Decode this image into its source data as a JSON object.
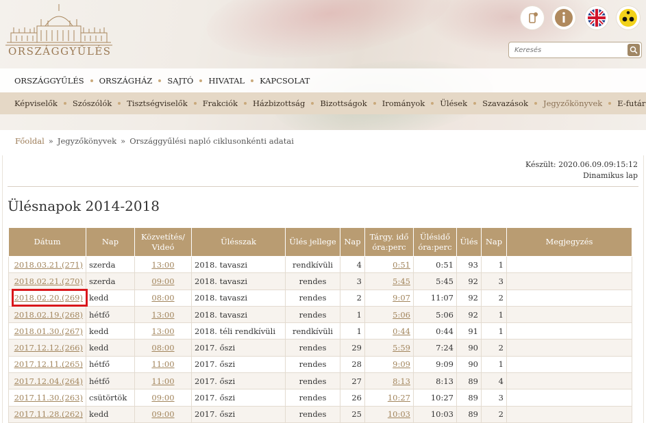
{
  "header": {
    "logo_text": "ORSZÁGGYŰLÉS",
    "search_placeholder": "Keresés",
    "icons": [
      "mobile-app-icon",
      "info-icon",
      "uk-flag-icon",
      "accessibility-icon"
    ]
  },
  "main_nav": [
    "ORSZÁGGYŰLÉS",
    "ORSZÁGHÁZ",
    "SAJTÓ",
    "HIVATAL",
    "KAPCSOLAT"
  ],
  "sub_nav": {
    "items": [
      "Képviselők",
      "Szószólók",
      "Tisztségviselők",
      "Frakciók",
      "Házbizottság",
      "Bizottságok",
      "Irományok",
      "Ülések",
      "Szavazások",
      "Jegyzőkönyvek",
      "E-futár"
    ],
    "active": "Jegyzőkönyvek"
  },
  "breadcrumb": {
    "home": "Főoldal",
    "separator": "»",
    "section": "Jegyzőkönyvek",
    "current": "Országgyűlési napló ciklusonkénti adatai"
  },
  "content": {
    "created": "Készült: 2020.06.09.09:15:12",
    "dynamic": "Dinamikus lap",
    "title": "Ülésnapok 2014-2018"
  },
  "table": {
    "headers": [
      "Dátum",
      "Nap",
      "Közvetítés/ Videó",
      "Ülésszak",
      "Ülés jellege",
      "Nap",
      "Tárgy. idő óra:perc",
      "Ülésidő óra:perc",
      "Ülés",
      "Nap",
      "Megjegyzés"
    ],
    "rows": [
      [
        "2018.03.21.(271)",
        "szerda",
        "13:00",
        "2018. tavaszi",
        "rendkívüli",
        "4",
        "0:51",
        "0:51",
        "93",
        "1",
        ""
      ],
      [
        "2018.02.21.(270)",
        "szerda",
        "09:00",
        "2018. tavaszi",
        "rendes",
        "3",
        "5:45",
        "5:45",
        "92",
        "3",
        ""
      ],
      [
        "2018.02.20.(269)",
        "kedd",
        "08:00",
        "2018. tavaszi",
        "rendes",
        "2",
        "9:07",
        "11:07",
        "92",
        "2",
        ""
      ],
      [
        "2018.02.19.(268)",
        "hétfő",
        "13:00",
        "2018. tavaszi",
        "rendes",
        "1",
        "5:06",
        "5:06",
        "92",
        "1",
        ""
      ],
      [
        "2018.01.30.(267)",
        "kedd",
        "13:00",
        "2018. téli rendkívüli",
        "rendkívüli",
        "1",
        "0:44",
        "0:44",
        "91",
        "1",
        ""
      ],
      [
        "2017.12.12.(266)",
        "kedd",
        "08:00",
        "2017. őszi",
        "rendes",
        "29",
        "5:59",
        "7:24",
        "90",
        "2",
        ""
      ],
      [
        "2017.12.11.(265)",
        "hétfő",
        "11:00",
        "2017. őszi",
        "rendes",
        "28",
        "9:09",
        "9:09",
        "90",
        "1",
        ""
      ],
      [
        "2017.12.04.(264)",
        "hétfő",
        "11:00",
        "2017. őszi",
        "rendes",
        "27",
        "8:13",
        "8:13",
        "89",
        "4",
        ""
      ],
      [
        "2017.11.30.(263)",
        "csütörtök",
        "09:00",
        "2017. őszi",
        "rendes",
        "26",
        "10:27",
        "10:27",
        "89",
        "3",
        ""
      ],
      [
        "2017.11.28.(262)",
        "kedd",
        "09:00",
        "2017. őszi",
        "rendes",
        "25",
        "10:03",
        "10:03",
        "89",
        "2",
        ""
      ]
    ]
  },
  "highlight": {
    "color": "#d9161b",
    "row": 2
  }
}
